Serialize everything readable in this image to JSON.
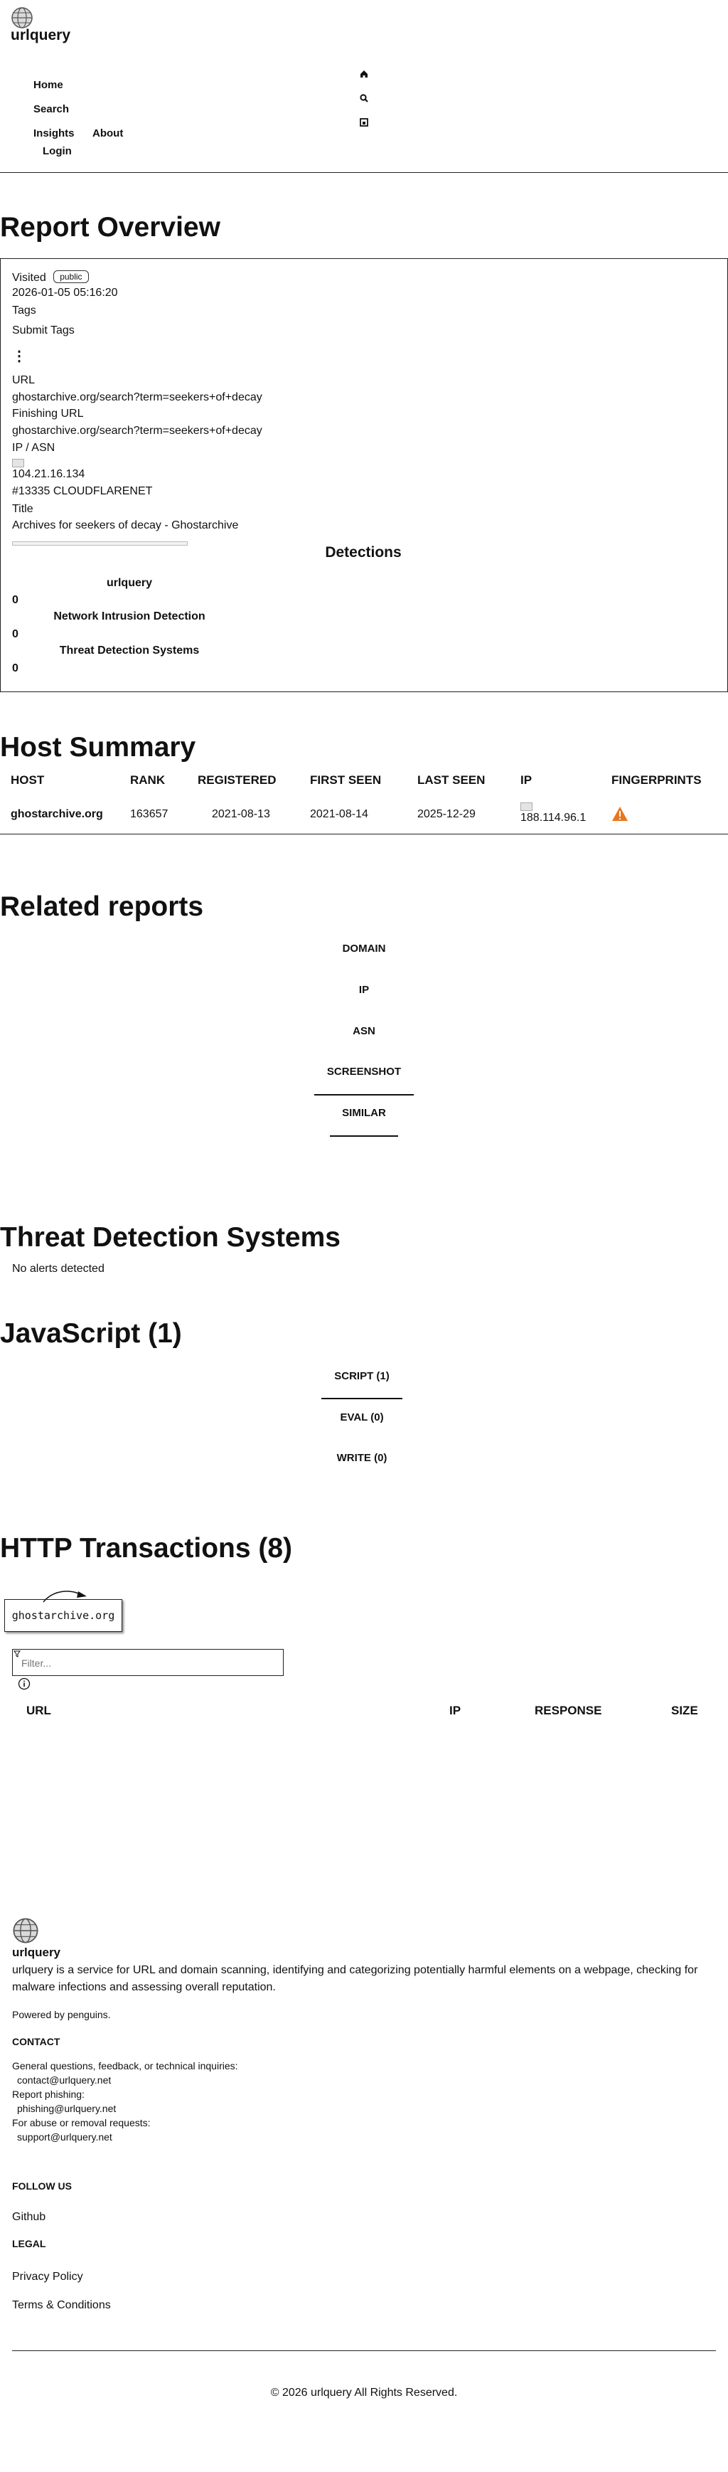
{
  "header": {
    "brand": "urlquery",
    "nav": [
      {
        "label": "Home",
        "icon": "home-icon"
      },
      {
        "label": "Search",
        "icon": "search-icon"
      },
      {
        "label": "Insights"
      },
      {
        "label": "About"
      },
      {
        "label": "Login"
      }
    ]
  },
  "overview": {
    "heading": "Report Overview",
    "visited_label": "Visited",
    "visibility_badge": "public",
    "timestamp": "2026-01-05 05:16:20",
    "tags_label": "Tags",
    "submit_tags": "Submit Tags",
    "url_label": "URL",
    "url": "ghostarchive.org/search?term=seekers+of+decay",
    "finishing_url_label": "Finishing URL",
    "finishing_url": "ghostarchive.org/search?term=seekers+of+decay",
    "ip_asn_label": "IP / ASN",
    "ip": "104.21.16.134",
    "asn": "#13335 CLOUDFLARENET",
    "title_label": "Title",
    "title": "Archives for seekers of decay - Ghostarchive",
    "detections_heading": "Detections",
    "detections": [
      {
        "name": "urlquery",
        "count": "0"
      },
      {
        "name": "Network Intrusion Detection",
        "count": "0"
      },
      {
        "name": "Threat Detection Systems",
        "count": "0"
      }
    ]
  },
  "host_summary": {
    "heading": "Host Summary",
    "columns": [
      "HOST",
      "RANK",
      "REGISTERED",
      "FIRST SEEN",
      "LAST SEEN",
      "IP",
      "FINGERPRINTS"
    ],
    "rows": [
      {
        "host": "ghostarchive.org",
        "rank": "163657",
        "registered": "2021-08-13",
        "first_seen": "2021-08-14",
        "last_seen": "2025-12-29",
        "ip": "188.114.96.1"
      }
    ],
    "warning_color": "#e8771f"
  },
  "related": {
    "heading": "Related reports",
    "tabs": [
      "DOMAIN",
      "IP",
      "ASN",
      "SCREENSHOT",
      "SIMILAR"
    ]
  },
  "tds": {
    "heading": "Threat Detection Systems",
    "message": "No alerts detected"
  },
  "javascript": {
    "heading": "JavaScript (1)",
    "tabs": [
      "SCRIPT (1)",
      "EVAL (0)",
      "WRITE (0)"
    ]
  },
  "http": {
    "heading": "HTTP Transactions (8)",
    "graph_node": "ghostarchive.org",
    "filter_placeholder": "Filter...",
    "columns": [
      "URL",
      "IP",
      "RESPONSE",
      "SIZE"
    ]
  },
  "footer": {
    "brand": "urlquery",
    "description": "urlquery is a service for URL and domain scanning, identifying and categorizing potentially harmful elements on a webpage, checking for malware infections and assessing overall reputation.",
    "powered": "Powered by penguins.",
    "contact_heading": "CONTACT",
    "general_label": "General questions, feedback, or technical inquiries:",
    "general_email": "contact@urlquery.net",
    "phishing_label": "Report phishing:",
    "phishing_email": "phishing@urlquery.net",
    "abuse_label": "For abuse or removal requests:",
    "abuse_email": "support@urlquery.net",
    "follow_heading": "FOLLOW US",
    "github": "Github",
    "legal_heading": "LEGAL",
    "privacy": "Privacy Policy",
    "terms": "Terms & Conditions",
    "copyright": "© 2026 urlquery All Rights Reserved."
  }
}
